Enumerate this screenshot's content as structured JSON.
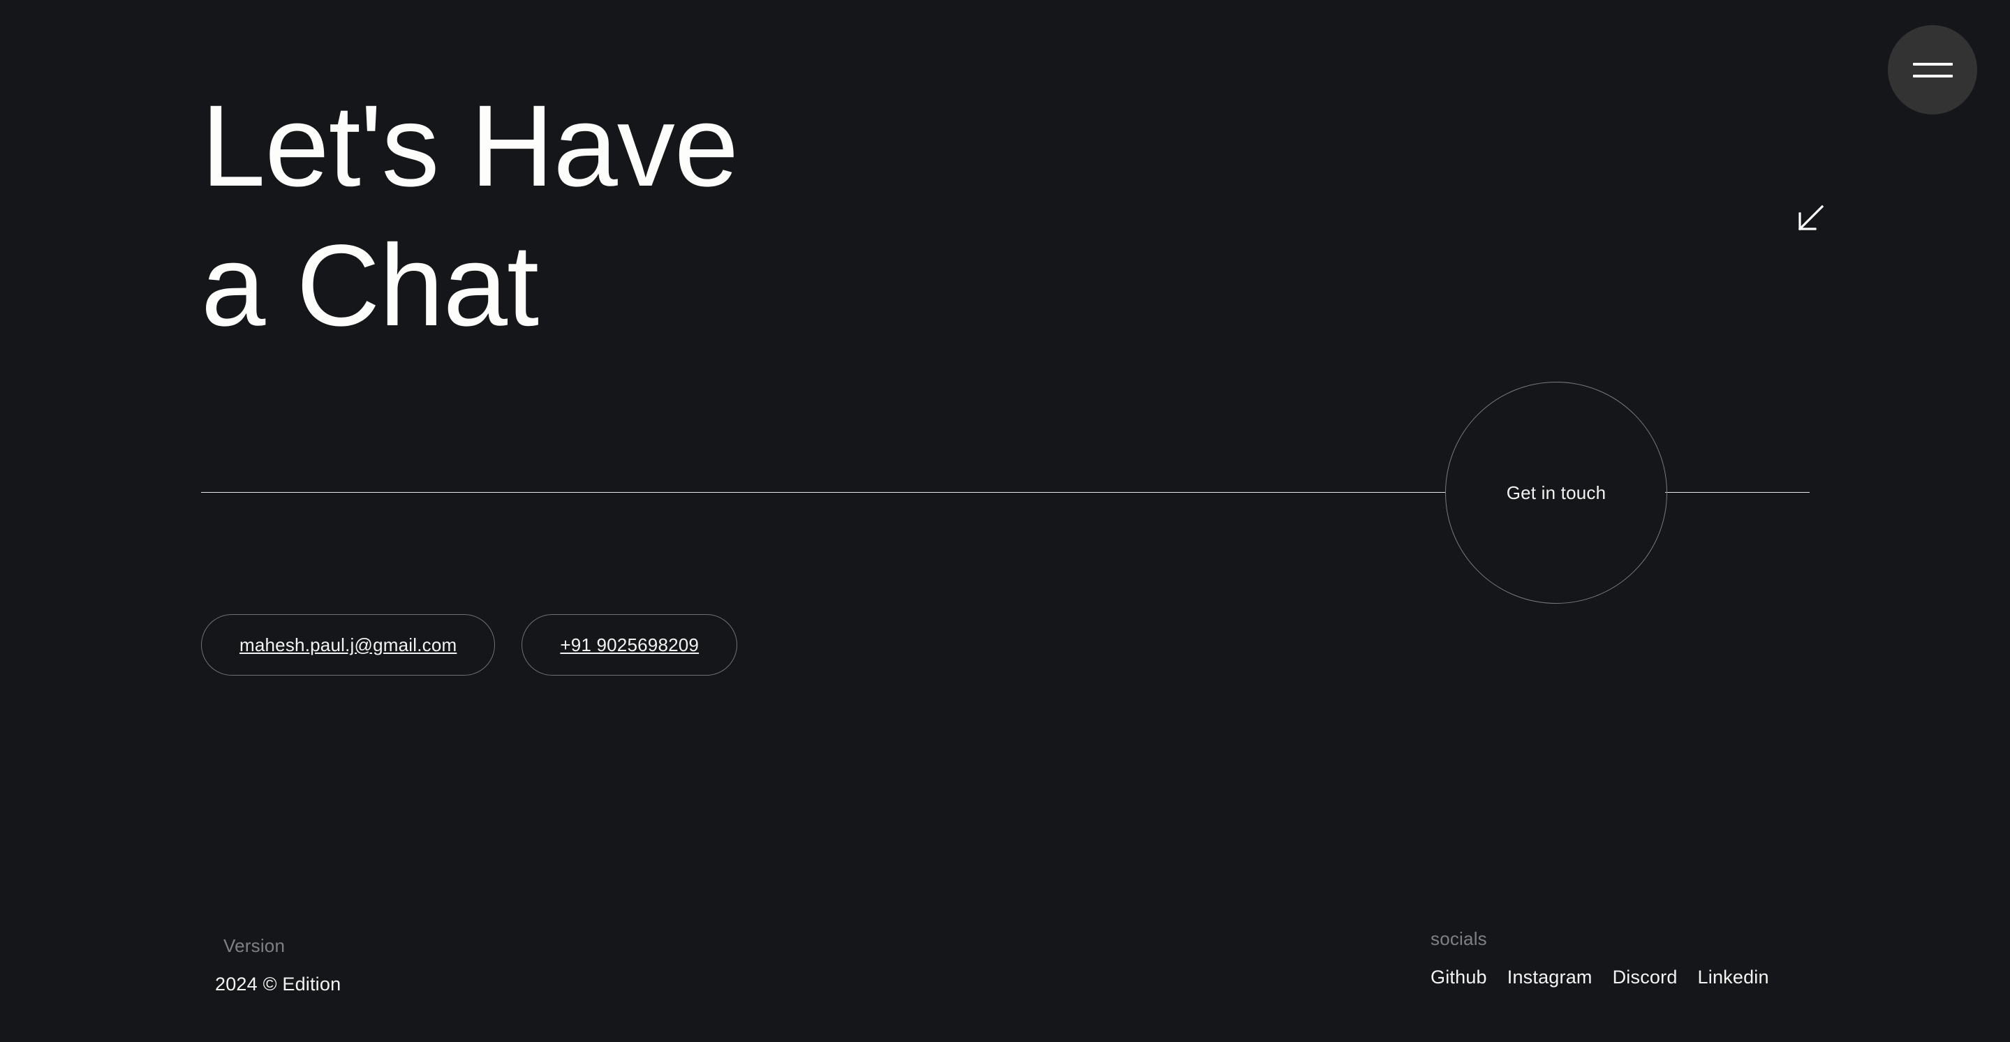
{
  "page": {
    "background_color": "#141619",
    "text_color": "#ffffff",
    "muted_text_color": "#7e8184",
    "line_color": "#e9e9e9",
    "outline_color": "#6e7275",
    "menu_button_color": "#333333"
  },
  "header": {
    "menu_button_label": "menu-toggle",
    "menu_icon": "hamburger-icon"
  },
  "hero": {
    "heading": "Let's Have\na Chat",
    "arrow_icon": "arrow-down-left-icon"
  },
  "cta": {
    "circle_label": "Get in touch"
  },
  "contacts": [
    {
      "name": "email",
      "label": "mahesh.paul.j@gmail.com"
    },
    {
      "name": "phone",
      "label": "+91 9025698209"
    }
  ],
  "footer": {
    "version_label": "Version",
    "edition": "2024 © Edition",
    "socials_label": "socials",
    "socials": [
      {
        "label": "Github"
      },
      {
        "label": "Instagram"
      },
      {
        "label": "Discord"
      },
      {
        "label": "Linkedin"
      }
    ]
  }
}
